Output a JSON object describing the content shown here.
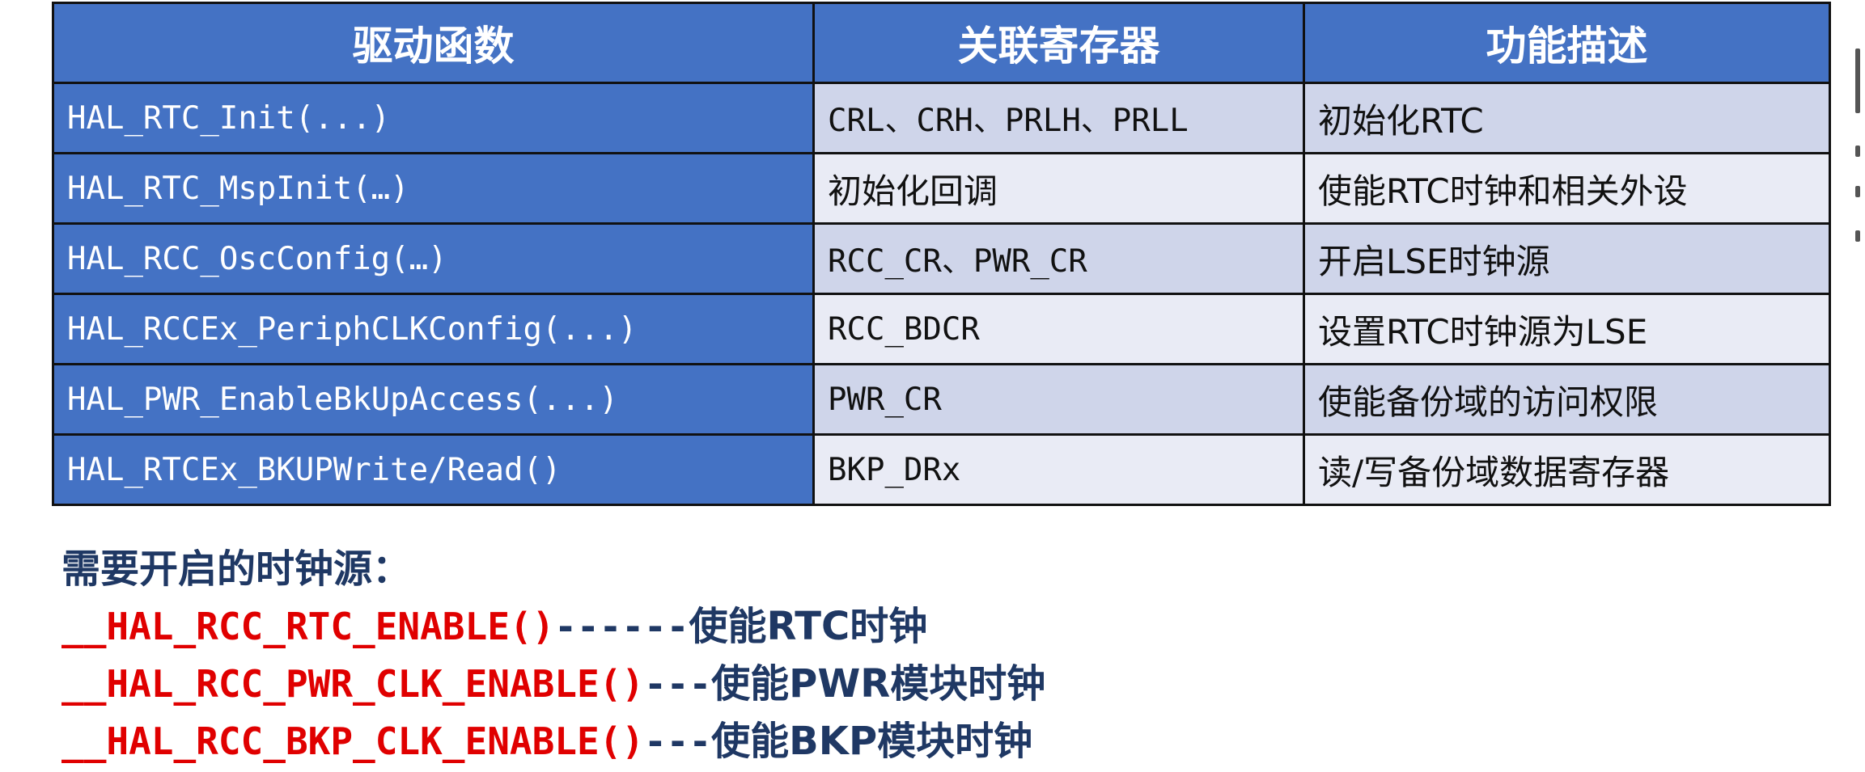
{
  "table": {
    "headers": [
      "驱动函数",
      "关联寄存器",
      "功能描述"
    ],
    "rows": [
      {
        "func": "HAL_RTC_Init(...)",
        "reg": "CRL、CRH、PRLH、PRLL",
        "desc": "初始化RTC"
      },
      {
        "func": "HAL_RTC_MspInit(…)",
        "reg": "初始化回调",
        "desc": "使能RTC时钟和相关外设"
      },
      {
        "func": "HAL_RCC_OscConfig(…)",
        "reg": "RCC_CR、PWR_CR",
        "desc": "开启LSE时钟源"
      },
      {
        "func": "HAL_RCCEx_PeriphCLKConfig(...)",
        "reg": "RCC_BDCR",
        "desc": "设置RTC时钟源为LSE"
      },
      {
        "func": "HAL_PWR_EnableBkUpAccess(...)",
        "reg": "PWR_CR",
        "desc": "使能备份域的访问权限"
      },
      {
        "func": "HAL_RTCEx_BKUPWrite/Read()",
        "reg": "BKP_DRx",
        "desc": "读/写备份域数据寄存器"
      }
    ]
  },
  "notes": {
    "title": "需要开启的时钟源：",
    "lines": [
      {
        "macro": "__HAL_RCC_RTC_ENABLE()",
        "sep": "------",
        "desc": "使能RTC时钟"
      },
      {
        "macro": "__HAL_RCC_PWR_CLK_ENABLE()",
        "sep": "---",
        "desc": "使能PWR模块时钟"
      },
      {
        "macro": "__HAL_RCC_BKP_CLK_ENABLE()",
        "sep": "---",
        "desc": "使能BKP模块时钟"
      }
    ]
  },
  "colors": {
    "header_bg": "#4472c4",
    "row_odd": "#cfd5ea",
    "row_even": "#e9ebf5",
    "macro_red": "#e00000",
    "note_navy": "#1f3864"
  }
}
